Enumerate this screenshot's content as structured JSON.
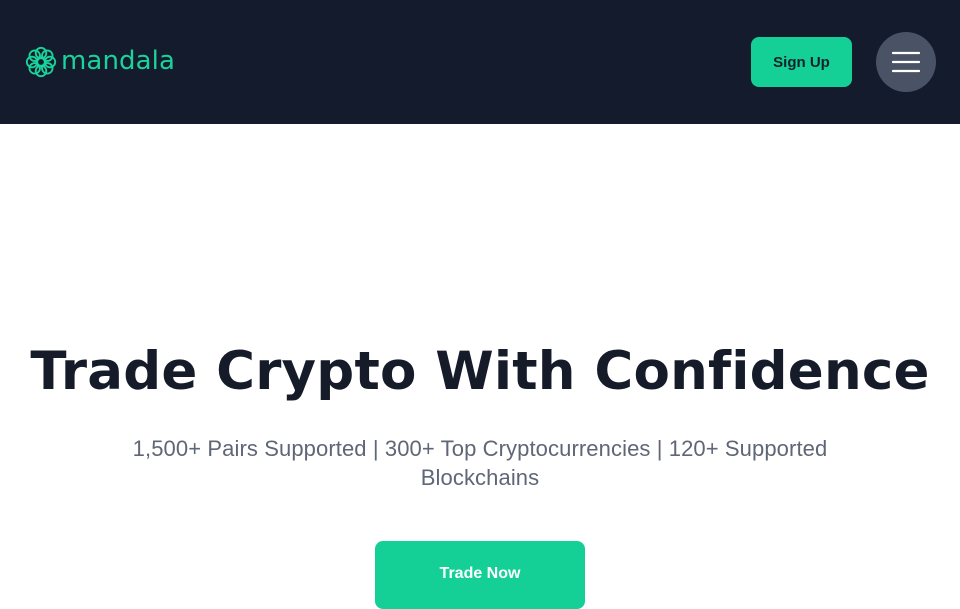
{
  "header": {
    "logo": {
      "text": "mandala",
      "icon": "mandala-flower-icon",
      "color": "#19d39a"
    },
    "signup_label": "Sign Up",
    "menu": {
      "icon": "hamburger-menu-icon"
    }
  },
  "hero": {
    "title": "Trade Crypto With Confidence",
    "subtitle": "1,500+ Pairs Supported | 300+ Top Cryptocurrencies | 120+ Supported Blockchains",
    "cta_label": "Trade Now"
  },
  "colors": {
    "header_background": "#141b2d",
    "accent": "#14d096",
    "menu_button": "#4a5266",
    "title_text": "#161b2a",
    "subtitle_text": "#5f6675"
  }
}
